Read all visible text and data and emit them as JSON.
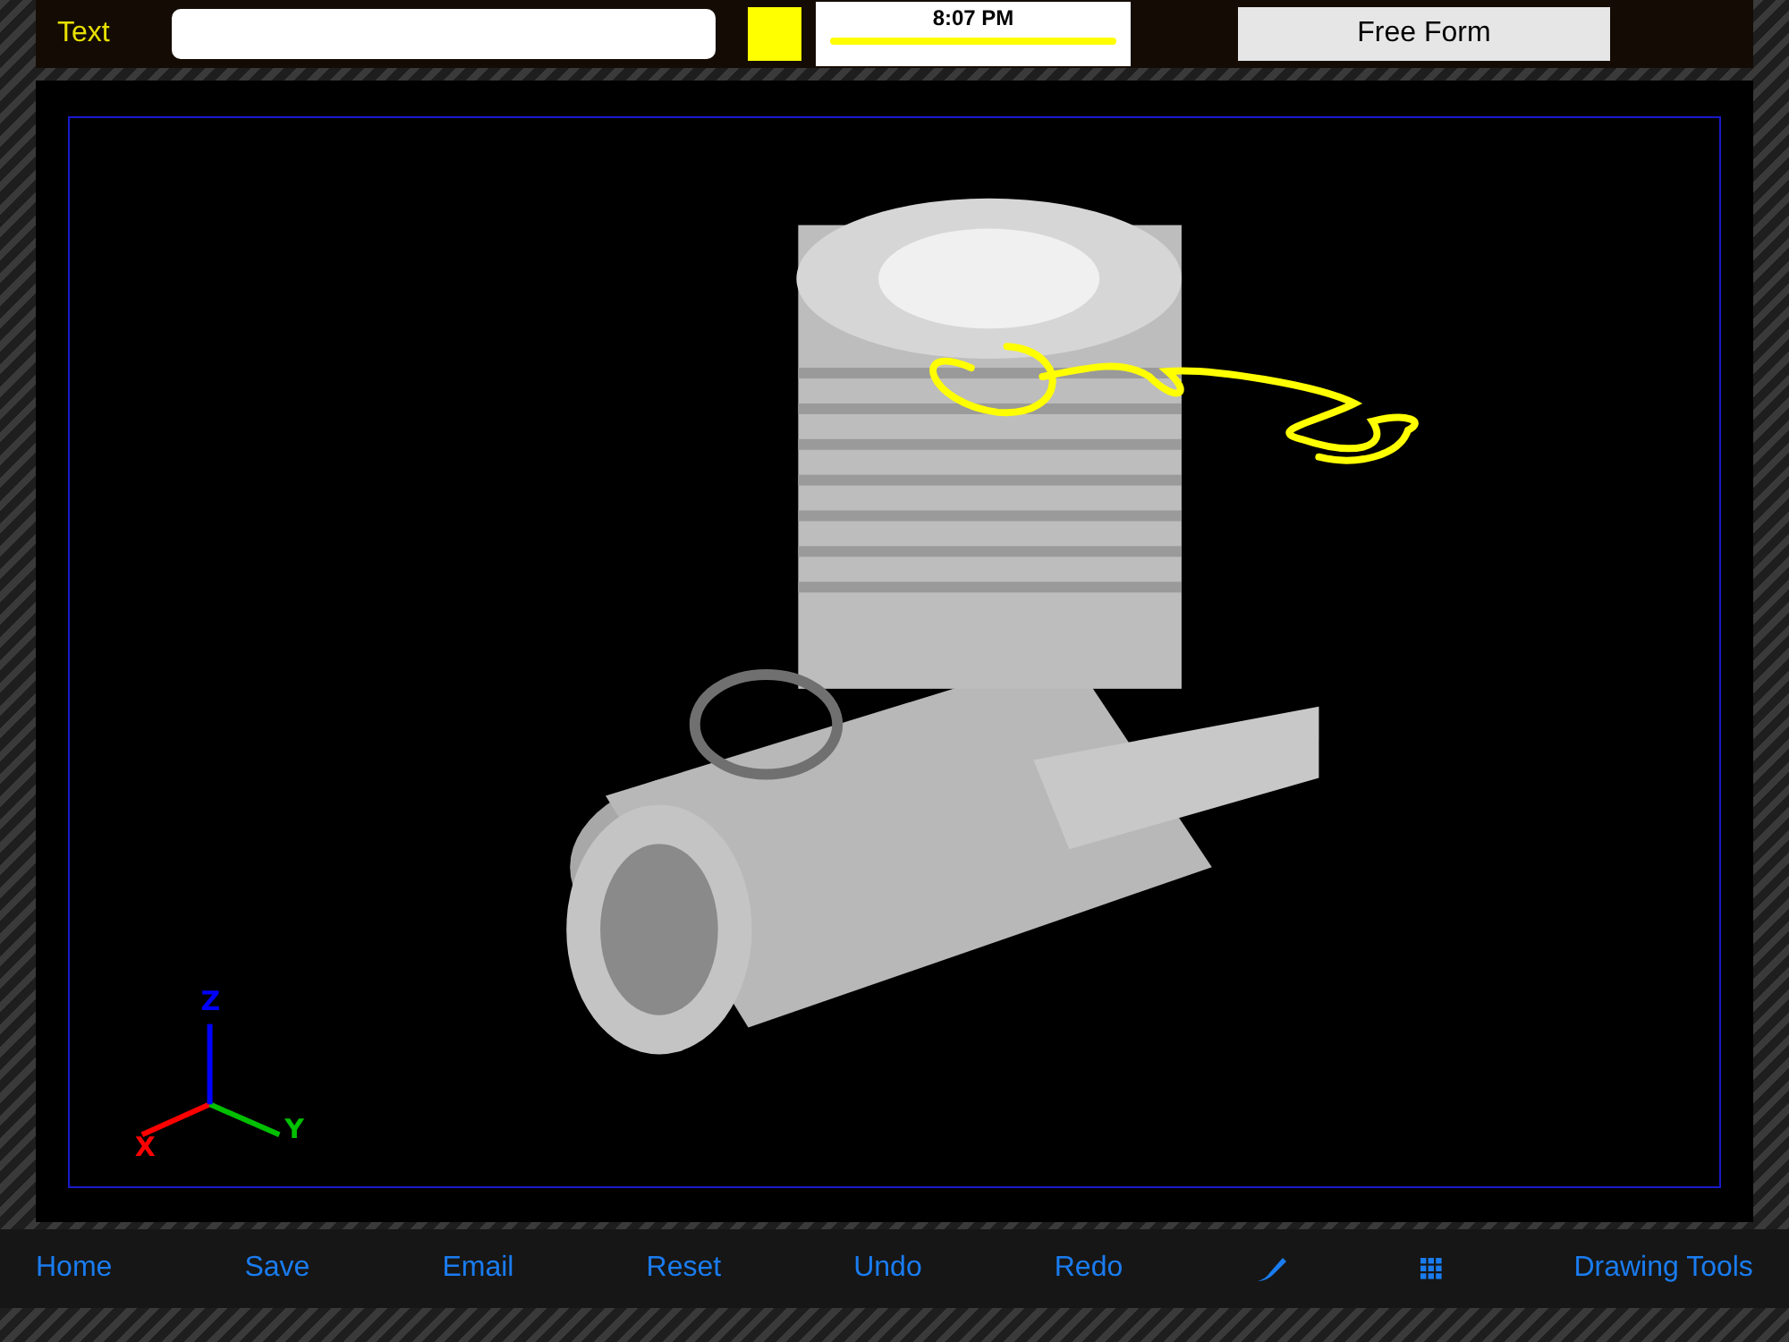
{
  "top_bar": {
    "text_button": "Text",
    "color_swatch": {
      "color": "#ffff00"
    },
    "stroke_preview": {
      "time": "8:07 PM",
      "color": "#ffff00"
    },
    "mode_button": "Free Form"
  },
  "viewport": {
    "axes": [
      {
        "label": "X",
        "color": "#ff0000"
      },
      {
        "label": "Y",
        "color": "#00c000"
      },
      {
        "label": "Z",
        "color": "#0000ff"
      }
    ],
    "annotation": {
      "color": "#ffff00"
    }
  },
  "toolbar": [
    {
      "kind": "text",
      "label": "Home"
    },
    {
      "kind": "text",
      "label": "Save"
    },
    {
      "kind": "text",
      "label": "Email"
    },
    {
      "kind": "text",
      "label": "Reset"
    },
    {
      "kind": "text",
      "label": "Undo"
    },
    {
      "kind": "text",
      "label": "Redo"
    },
    {
      "kind": "brush"
    },
    {
      "kind": "grid"
    },
    {
      "kind": "text",
      "label": "Drawing Tools"
    }
  ]
}
